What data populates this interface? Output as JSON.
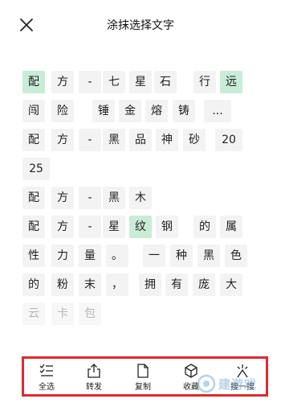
{
  "header": {
    "title": "涂抹选择文字"
  },
  "rows": [
    [
      {
        "text": "配",
        "state": "sel"
      },
      {
        "text": "方",
        "state": "normal"
      },
      {
        "text": "-",
        "state": "normal"
      },
      {
        "text": "七",
        "state": "normal"
      },
      {
        "text": "星",
        "state": "normal"
      },
      {
        "text": "石",
        "state": "normal"
      },
      {
        "text": "行",
        "state": "normal"
      },
      {
        "text": "远",
        "state": "sel"
      }
    ],
    [
      {
        "text": "闯",
        "state": "normal"
      },
      {
        "text": "险",
        "state": "normal"
      },
      {
        "text": "锤",
        "state": "normal"
      },
      {
        "text": "金",
        "state": "normal"
      },
      {
        "text": "熔",
        "state": "normal"
      },
      {
        "text": "铸",
        "state": "normal"
      },
      {
        "text": "...",
        "state": "normal"
      }
    ],
    [
      {
        "text": "配",
        "state": "normal"
      },
      {
        "text": "方",
        "state": "normal"
      },
      {
        "text": "-",
        "state": "normal"
      },
      {
        "text": "黑",
        "state": "normal"
      },
      {
        "text": "品",
        "state": "normal"
      },
      {
        "text": "神",
        "state": "normal"
      },
      {
        "text": "砂",
        "state": "normal"
      },
      {
        "text": "20",
        "state": "normal"
      }
    ],
    [
      {
        "text": "25",
        "state": "normal"
      }
    ],
    [
      {
        "text": "配",
        "state": "normal"
      },
      {
        "text": "方",
        "state": "normal"
      },
      {
        "text": "-",
        "state": "normal"
      },
      {
        "text": "黑",
        "state": "normal"
      },
      {
        "text": "木",
        "state": "normal"
      }
    ],
    [
      {
        "text": "配",
        "state": "normal"
      },
      {
        "text": "方",
        "state": "normal"
      },
      {
        "text": "-",
        "state": "normal"
      },
      {
        "text": "星",
        "state": "normal"
      },
      {
        "text": "纹",
        "state": "sel"
      },
      {
        "text": "钢",
        "state": "normal"
      },
      {
        "text": "的",
        "state": "normal"
      },
      {
        "text": "属",
        "state": "normal"
      }
    ],
    [
      {
        "text": "性",
        "state": "normal"
      },
      {
        "text": "力",
        "state": "normal"
      },
      {
        "text": "量",
        "state": "normal"
      },
      {
        "text": "。",
        "state": "normal"
      },
      {
        "text": "一",
        "state": "normal"
      },
      {
        "text": "种",
        "state": "normal"
      },
      {
        "text": "黑",
        "state": "normal"
      },
      {
        "text": "色",
        "state": "normal"
      }
    ],
    [
      {
        "text": "的",
        "state": "normal"
      },
      {
        "text": "粉",
        "state": "normal"
      },
      {
        "text": "末",
        "state": "normal"
      },
      {
        "text": "，",
        "state": "normal"
      },
      {
        "text": "拥",
        "state": "normal"
      },
      {
        "text": "有",
        "state": "normal"
      },
      {
        "text": "庞",
        "state": "normal"
      },
      {
        "text": "大",
        "state": "normal"
      }
    ],
    [
      {
        "text": "云",
        "state": "dim"
      },
      {
        "text": "卡",
        "state": "dim"
      },
      {
        "text": "包",
        "state": "dim"
      }
    ]
  ],
  "toolbar": {
    "items": [
      {
        "id": "select-all",
        "label": "全选",
        "icon": "checklist-icon"
      },
      {
        "id": "forward",
        "label": "转发",
        "icon": "share-icon"
      },
      {
        "id": "copy",
        "label": "复制",
        "icon": "document-icon"
      },
      {
        "id": "favorite",
        "label": "收藏",
        "icon": "cube-icon"
      },
      {
        "id": "search",
        "label": "搜一搜",
        "icon": "search-spark-icon"
      }
    ]
  },
  "watermark": {
    "text": "建游戏",
    "color": "#7cb0d8"
  }
}
